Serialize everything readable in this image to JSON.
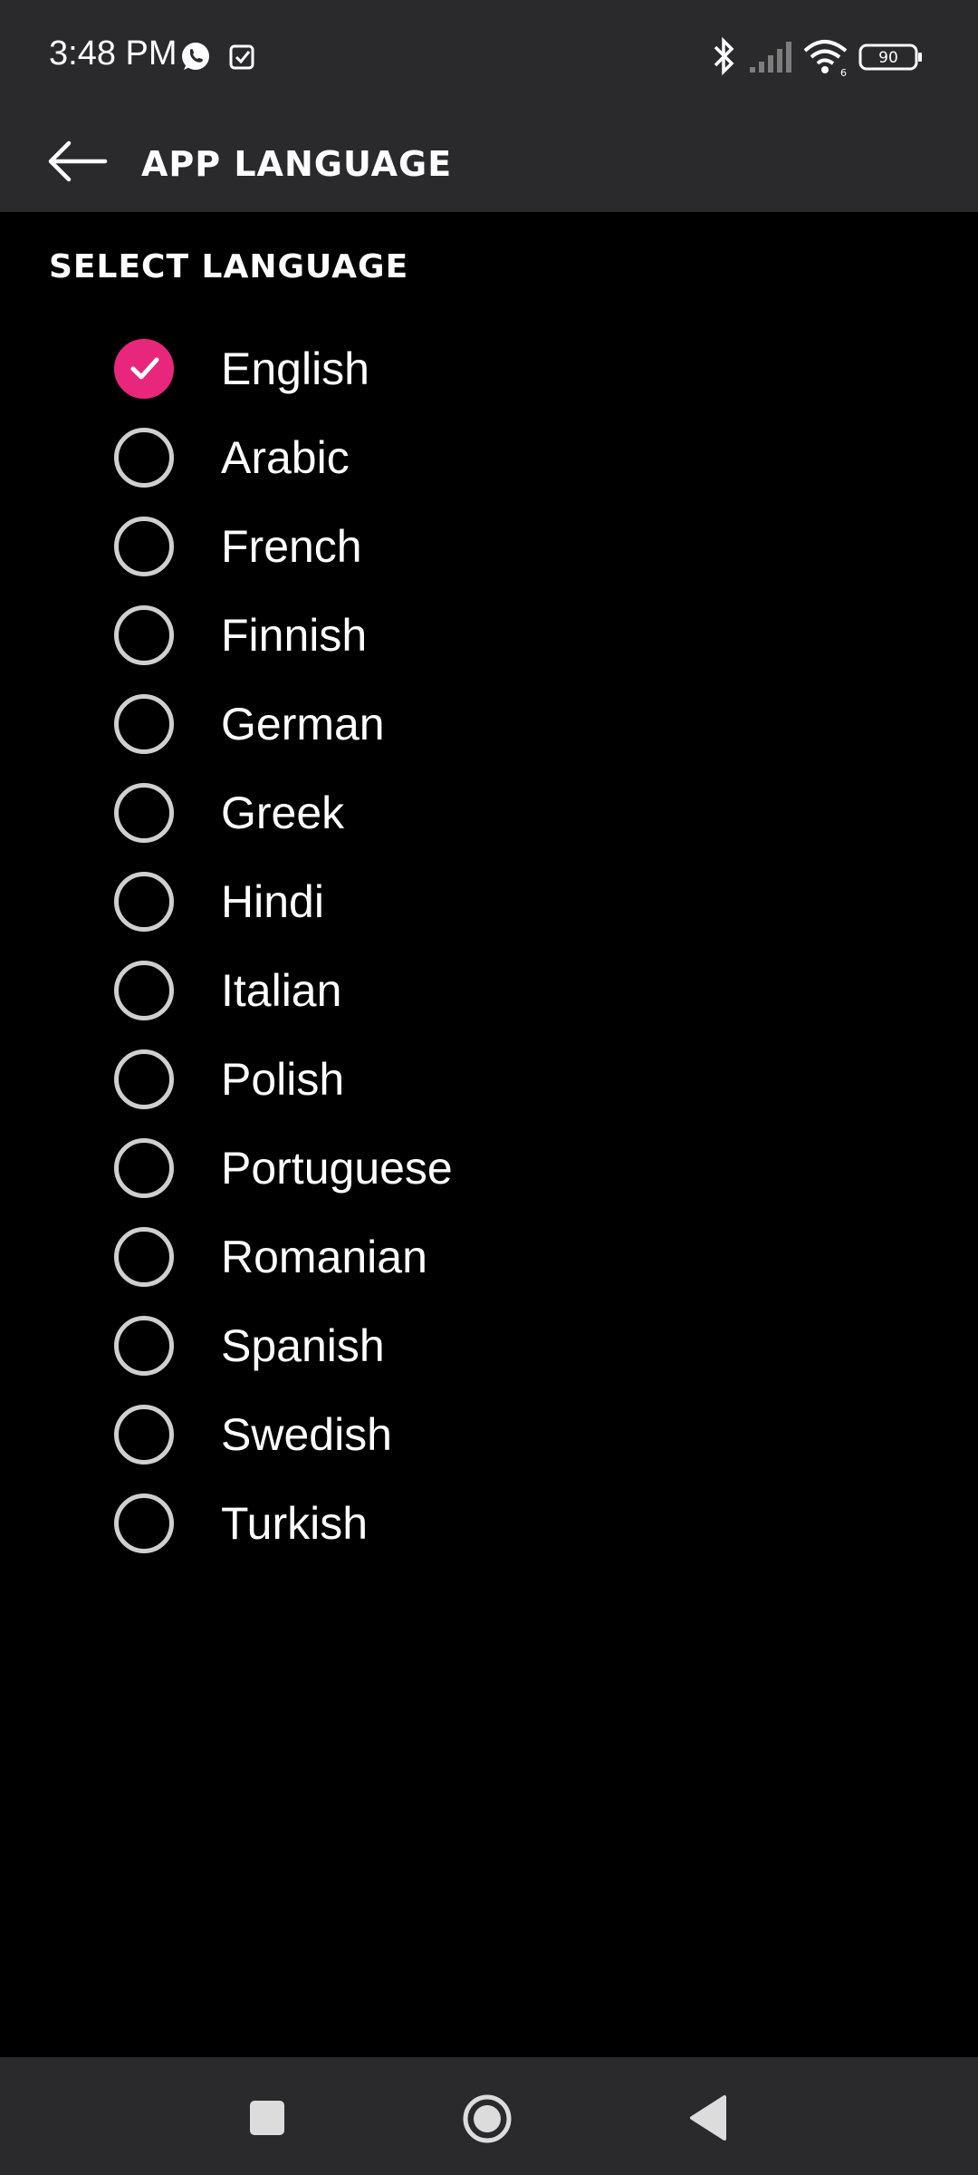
{
  "status_bar": {
    "time": "3:48 PM",
    "battery": "90",
    "icons": [
      "whatsapp-icon",
      "task-check-icon",
      "bluetooth-icon",
      "signal-icon",
      "wifi-icon",
      "battery-icon"
    ]
  },
  "app_bar": {
    "title": "APP LANGUAGE",
    "back_icon": "arrow-left-icon"
  },
  "section": {
    "title": "SELECT LANGUAGE"
  },
  "languages": [
    {
      "label": "English",
      "selected": true
    },
    {
      "label": "Arabic",
      "selected": false
    },
    {
      "label": "French",
      "selected": false
    },
    {
      "label": "Finnish",
      "selected": false
    },
    {
      "label": "German",
      "selected": false
    },
    {
      "label": "Greek",
      "selected": false
    },
    {
      "label": "Hindi",
      "selected": false
    },
    {
      "label": "Italian",
      "selected": false
    },
    {
      "label": "Polish",
      "selected": false
    },
    {
      "label": "Portuguese",
      "selected": false
    },
    {
      "label": "Romanian",
      "selected": false
    },
    {
      "label": "Spanish",
      "selected": false
    },
    {
      "label": "Swedish",
      "selected": false
    },
    {
      "label": "Turkish",
      "selected": false
    }
  ],
  "colors": {
    "accent": "#e8277c",
    "bar_background": "#2a292c",
    "background": "#000000"
  },
  "nav_bar": {
    "icons": [
      "recents-square-icon",
      "home-circle-icon",
      "back-triangle-icon"
    ]
  }
}
